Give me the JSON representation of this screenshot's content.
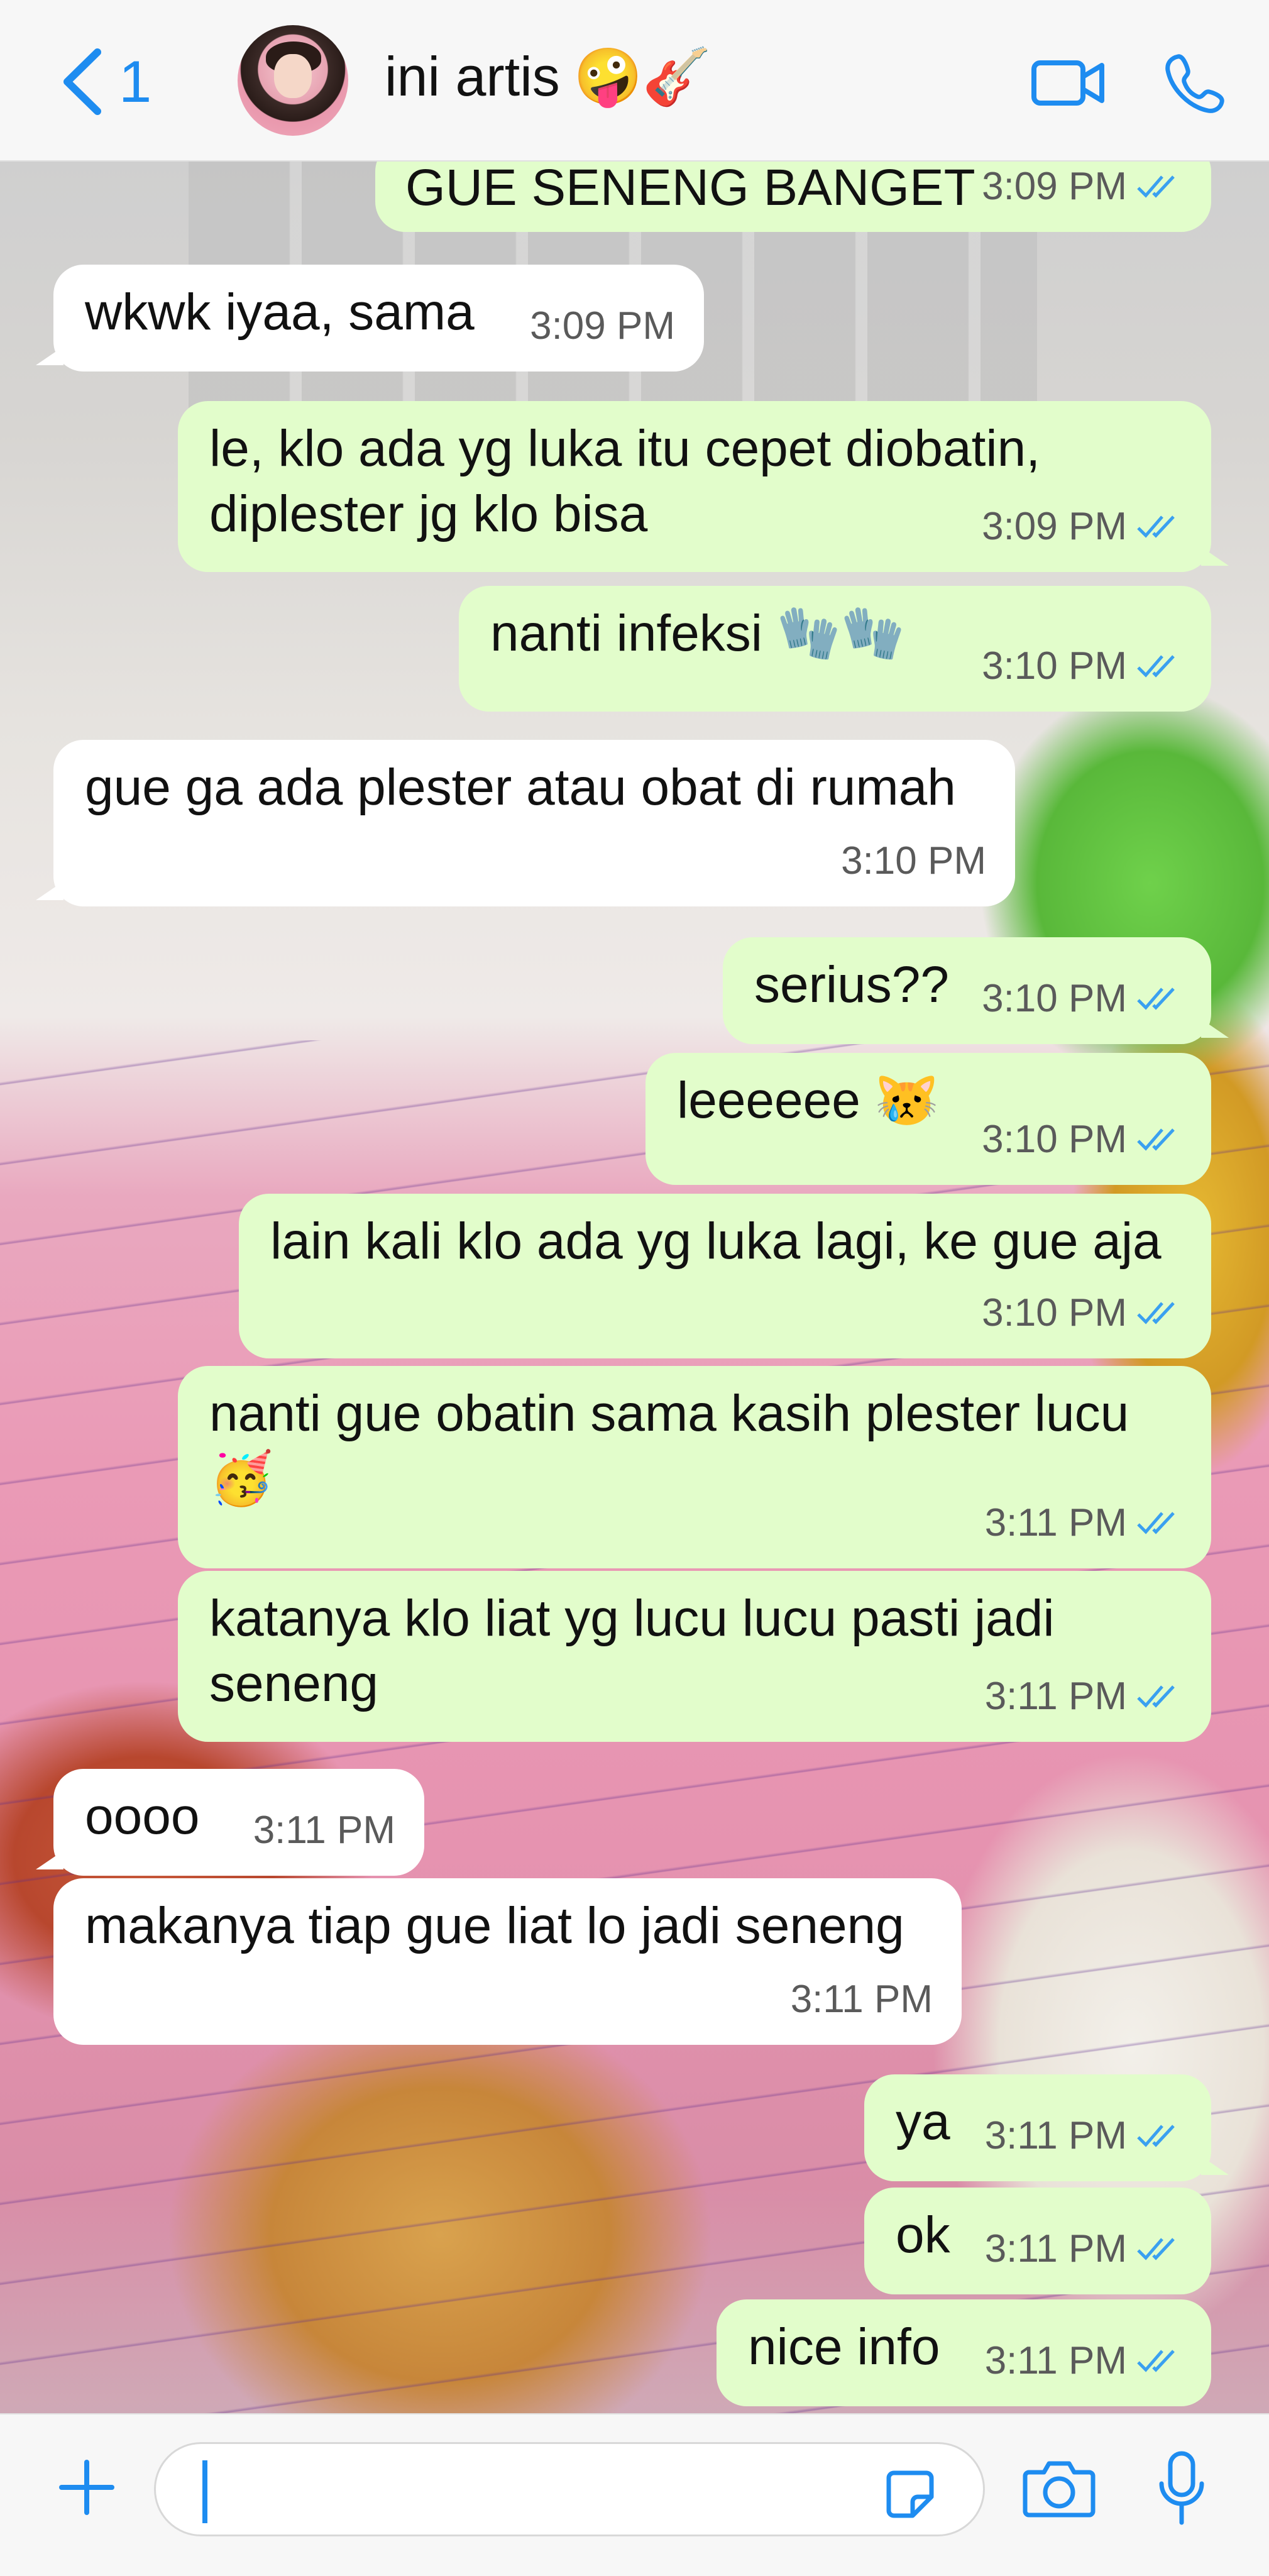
{
  "header": {
    "back_count": "1",
    "contact_name": "ini artis",
    "name_emojis": "🤪🎸"
  },
  "messages": [
    {
      "dir": "out",
      "text": "GUE SENENG BANGET",
      "time": "3:09 PM",
      "ticks": true
    },
    {
      "dir": "in",
      "text": "wkwk iyaa, sama",
      "time": "3:09 PM"
    },
    {
      "dir": "out",
      "text": "le, klo ada yg luka itu cepet diobatin,\ndiplester jg klo bisa",
      "time": "3:09 PM",
      "ticks": true
    },
    {
      "dir": "out",
      "text": "nanti infeksi 🧤🧤",
      "time": "3:10 PM",
      "ticks": true
    },
    {
      "dir": "in",
      "text": "gue ga ada plester atau obat di rumah",
      "time": "3:10 PM"
    },
    {
      "dir": "out",
      "text": "serius??",
      "time": "3:10 PM",
      "ticks": true
    },
    {
      "dir": "out",
      "text": "leeeeee 😿",
      "time": "3:10 PM",
      "ticks": true
    },
    {
      "dir": "out",
      "text": "lain kali klo ada yg luka lagi, ke gue aja",
      "time": "3:10 PM",
      "ticks": true
    },
    {
      "dir": "out",
      "text": "nanti gue obatin sama kasih plester lucu\n🥳",
      "time": "3:11 PM",
      "ticks": true
    },
    {
      "dir": "out",
      "text": "katanya klo liat yg lucu lucu pasti jadi\nseneng",
      "time": "3:11 PM",
      "ticks": true
    },
    {
      "dir": "in",
      "text": "oooo",
      "time": "3:11 PM"
    },
    {
      "dir": "in",
      "text": "makanya tiap gue liat lo jadi seneng",
      "time": "3:11 PM"
    },
    {
      "dir": "out",
      "text": "ya",
      "time": "3:11 PM",
      "ticks": true
    },
    {
      "dir": "out",
      "text": "ok",
      "time": "3:11 PM",
      "ticks": true
    },
    {
      "dir": "out",
      "text": "nice info",
      "time": "3:11 PM",
      "ticks": true
    }
  ],
  "composer": {
    "placeholder": "",
    "value": ""
  },
  "colors": {
    "accent": "#1e8cf0",
    "outgoing_bubble": "#e2fdcb",
    "incoming_bubble": "#ffffff",
    "tick": "#3aa0f0"
  }
}
